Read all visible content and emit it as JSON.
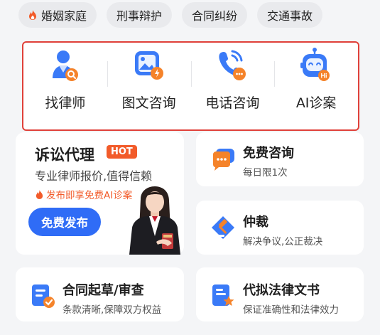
{
  "categories": [
    {
      "label": "婚姻家庭",
      "icon": "fire-icon"
    },
    {
      "label": "刑事辩护"
    },
    {
      "label": "合同纠纷"
    },
    {
      "label": "交通事故"
    }
  ],
  "services": [
    {
      "label": "找律师",
      "icon": "find-lawyer-icon"
    },
    {
      "label": "图文咨询",
      "icon": "image-text-consult-icon"
    },
    {
      "label": "电话咨询",
      "icon": "phone-consult-icon"
    },
    {
      "label": "AI诊案",
      "icon": "ai-robot-icon"
    }
  ],
  "litigation": {
    "title": "诉讼代理",
    "badge": "HOT",
    "subtitle": "专业律师报价,值得信赖",
    "promo": "发布即享免费AI诊案",
    "button": "免费发布"
  },
  "free_consult": {
    "title": "免费咨询",
    "desc": "每日限1次"
  },
  "arbitration": {
    "title": "仲裁",
    "desc": "解决争议,公正裁决"
  },
  "contract": {
    "title": "合同起草/审查",
    "desc": "条款清晰,保障双方权益"
  },
  "legal_doc": {
    "title": "代拟法律文书",
    "desc": "保证准确性和法律效力"
  },
  "colors": {
    "accent": "#2f6cf6",
    "hot": "#f25b2a",
    "highlight_border": "#e0413a"
  }
}
